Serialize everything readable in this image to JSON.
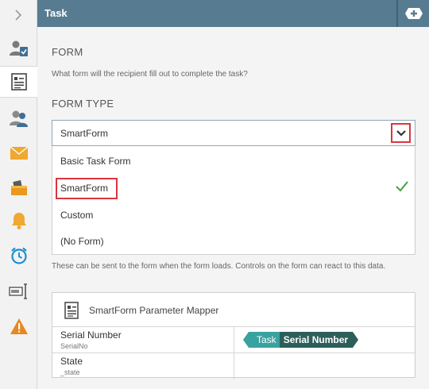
{
  "header": {
    "title": "Task"
  },
  "form_section": {
    "heading": "FORM",
    "description": "What form will the recipient fill out to complete the task?"
  },
  "form_type": {
    "heading": "FORM TYPE",
    "selected": "SmartForm",
    "options": [
      "Basic Task Form",
      "SmartForm",
      "Custom",
      "(No Form)"
    ]
  },
  "parameters_hint": "These can be sent to the form when the form loads. Controls on the form can react to this data.",
  "mapper": {
    "title": "SmartForm Parameter Mapper",
    "rows": [
      {
        "name": "Serial Number",
        "system_name": "SerialNo",
        "value_source": "Task",
        "value_field": "Serial Number"
      },
      {
        "name": "State",
        "system_name": "_state",
        "value_source": "",
        "value_field": ""
      }
    ]
  },
  "icons": {
    "rail": [
      "chevron-right-icon",
      "user-task-icon",
      "form-icon",
      "participants-icon",
      "email-icon",
      "inbox-icon",
      "bell-icon",
      "alarm-clock-icon",
      "text-field-icon",
      "warning-icon"
    ],
    "header": "add-tab-icon"
  },
  "colors": {
    "header": "#577c92",
    "highlight": "#d9363e",
    "check": "#46a04a",
    "token_primary": "#39a2a0",
    "token_secondary": "#2d5f5a"
  }
}
